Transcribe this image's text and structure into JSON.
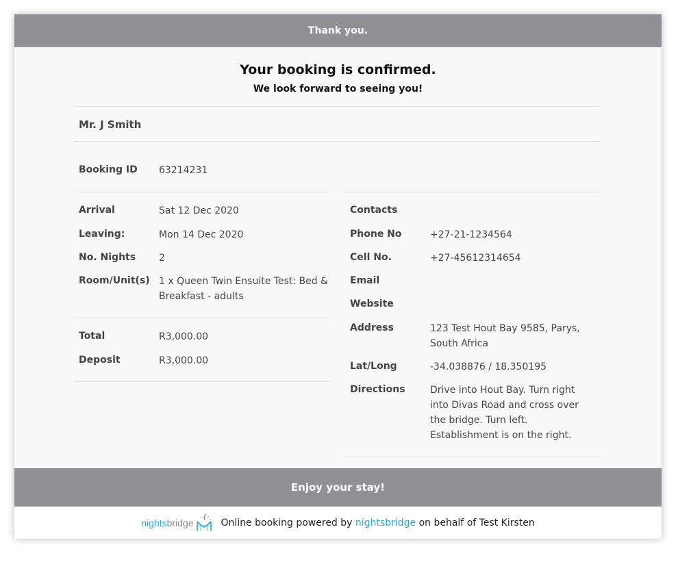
{
  "header": {
    "title": "Thank you."
  },
  "confirmation": {
    "headline": "Your booking is confirmed.",
    "subline": "We look forward to seeing you!"
  },
  "guest": {
    "name": "Mr. J Smith"
  },
  "booking": {
    "id_label": "Booking ID",
    "id_value": "63214231"
  },
  "stay": {
    "arrival_label": "Arrival",
    "arrival_value": "Sat 12 Dec 2020",
    "leaving_label": "Leaving:",
    "leaving_value": "Mon 14 Dec 2020",
    "nights_label": "No. Nights",
    "nights_value": "2",
    "room_label": "Room/Unit(s)",
    "room_value": "1 x Queen Twin Ensuite Test: Bed & Breakfast - adults"
  },
  "payment": {
    "total_label": "Total",
    "total_value": "R3,000.00",
    "deposit_label": "Deposit",
    "deposit_value": "R3,000.00"
  },
  "contacts": {
    "heading": "Contacts",
    "phone_label": "Phone No",
    "phone_value": "+27-21-1234564",
    "cell_label": "Cell No.",
    "cell_value": "+27-45612314654",
    "email_label": "Email",
    "email_value": "",
    "website_label": "Website",
    "website_value": "",
    "address_label": "Address",
    "address_value": "123 Test Hout Bay 9585, Parys, South Africa",
    "latlong_label": "Lat/Long",
    "latlong_value": "-34.038876 / 18.350195",
    "directions_label": "Directions",
    "directions_value": "Drive into Hout Bay. Turn right into Divas Road and cross over the bridge. Turn left. Establishment is on the right."
  },
  "closing": {
    "message": "Enjoy your stay!"
  },
  "footer": {
    "logo_nights": "nights",
    "logo_bridge": "bridge",
    "prefix": "Online booking powered by",
    "brand": "nightsbridge",
    "suffix": "on behalf of Test Kirsten"
  },
  "colors": {
    "banner": "#909095",
    "accent": "#2aa7d6"
  }
}
